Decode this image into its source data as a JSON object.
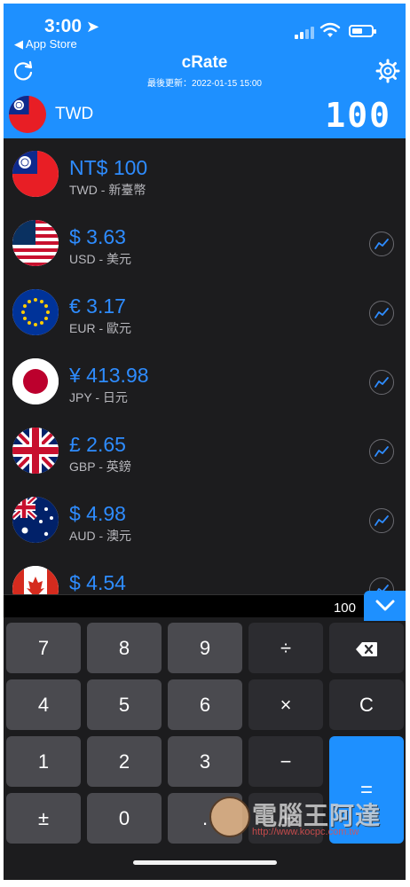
{
  "status_bar": {
    "time": "3:00",
    "back_label": "◀ App Store",
    "battery_level": 0.55
  },
  "header": {
    "title": "cRate",
    "subtitle": "最後更新：2022-01-15 15:00",
    "base_currency": "TWD",
    "base_amount": "100"
  },
  "currencies": [
    {
      "amount": "NT$ 100",
      "name": "TWD - 新臺幣",
      "flag": "taiwan-flag",
      "trend": false
    },
    {
      "amount": "$ 3.63",
      "name": "USD - 美元",
      "flag": "usa-flag",
      "trend": true
    },
    {
      "amount": "€ 3.17",
      "name": "EUR - 歐元",
      "flag": "eu-flag",
      "trend": true
    },
    {
      "amount": "¥ 413.98",
      "name": "JPY - 日元",
      "flag": "japan-flag",
      "trend": true
    },
    {
      "amount": "£ 2.65",
      "name": "GBP - 英鎊",
      "flag": "uk-flag",
      "trend": true
    },
    {
      "amount": "$ 4.98",
      "name": "AUD - 澳元",
      "flag": "australia-flag",
      "trend": true
    },
    {
      "amount": "$ 4.54",
      "name": "",
      "flag": "canada-flag",
      "trend": true
    }
  ],
  "keypad": {
    "display": "100",
    "keys": {
      "k7": "7",
      "k8": "8",
      "k9": "9",
      "div": "÷",
      "k4": "4",
      "k5": "5",
      "k6": "6",
      "mul": "×",
      "clear": "C",
      "k1": "1",
      "k2": "2",
      "k3": "3",
      "minus": "−",
      "sign": "±",
      "k0": "0",
      "dot": ".",
      "plus": "+",
      "eq": "="
    }
  },
  "watermark": {
    "text": "電腦王阿達",
    "url": "http://www.kocpc.com.tw"
  },
  "colors": {
    "accent": "#1e90ff",
    "amount": "#2e8cff",
    "background": "#1c1c1e"
  }
}
